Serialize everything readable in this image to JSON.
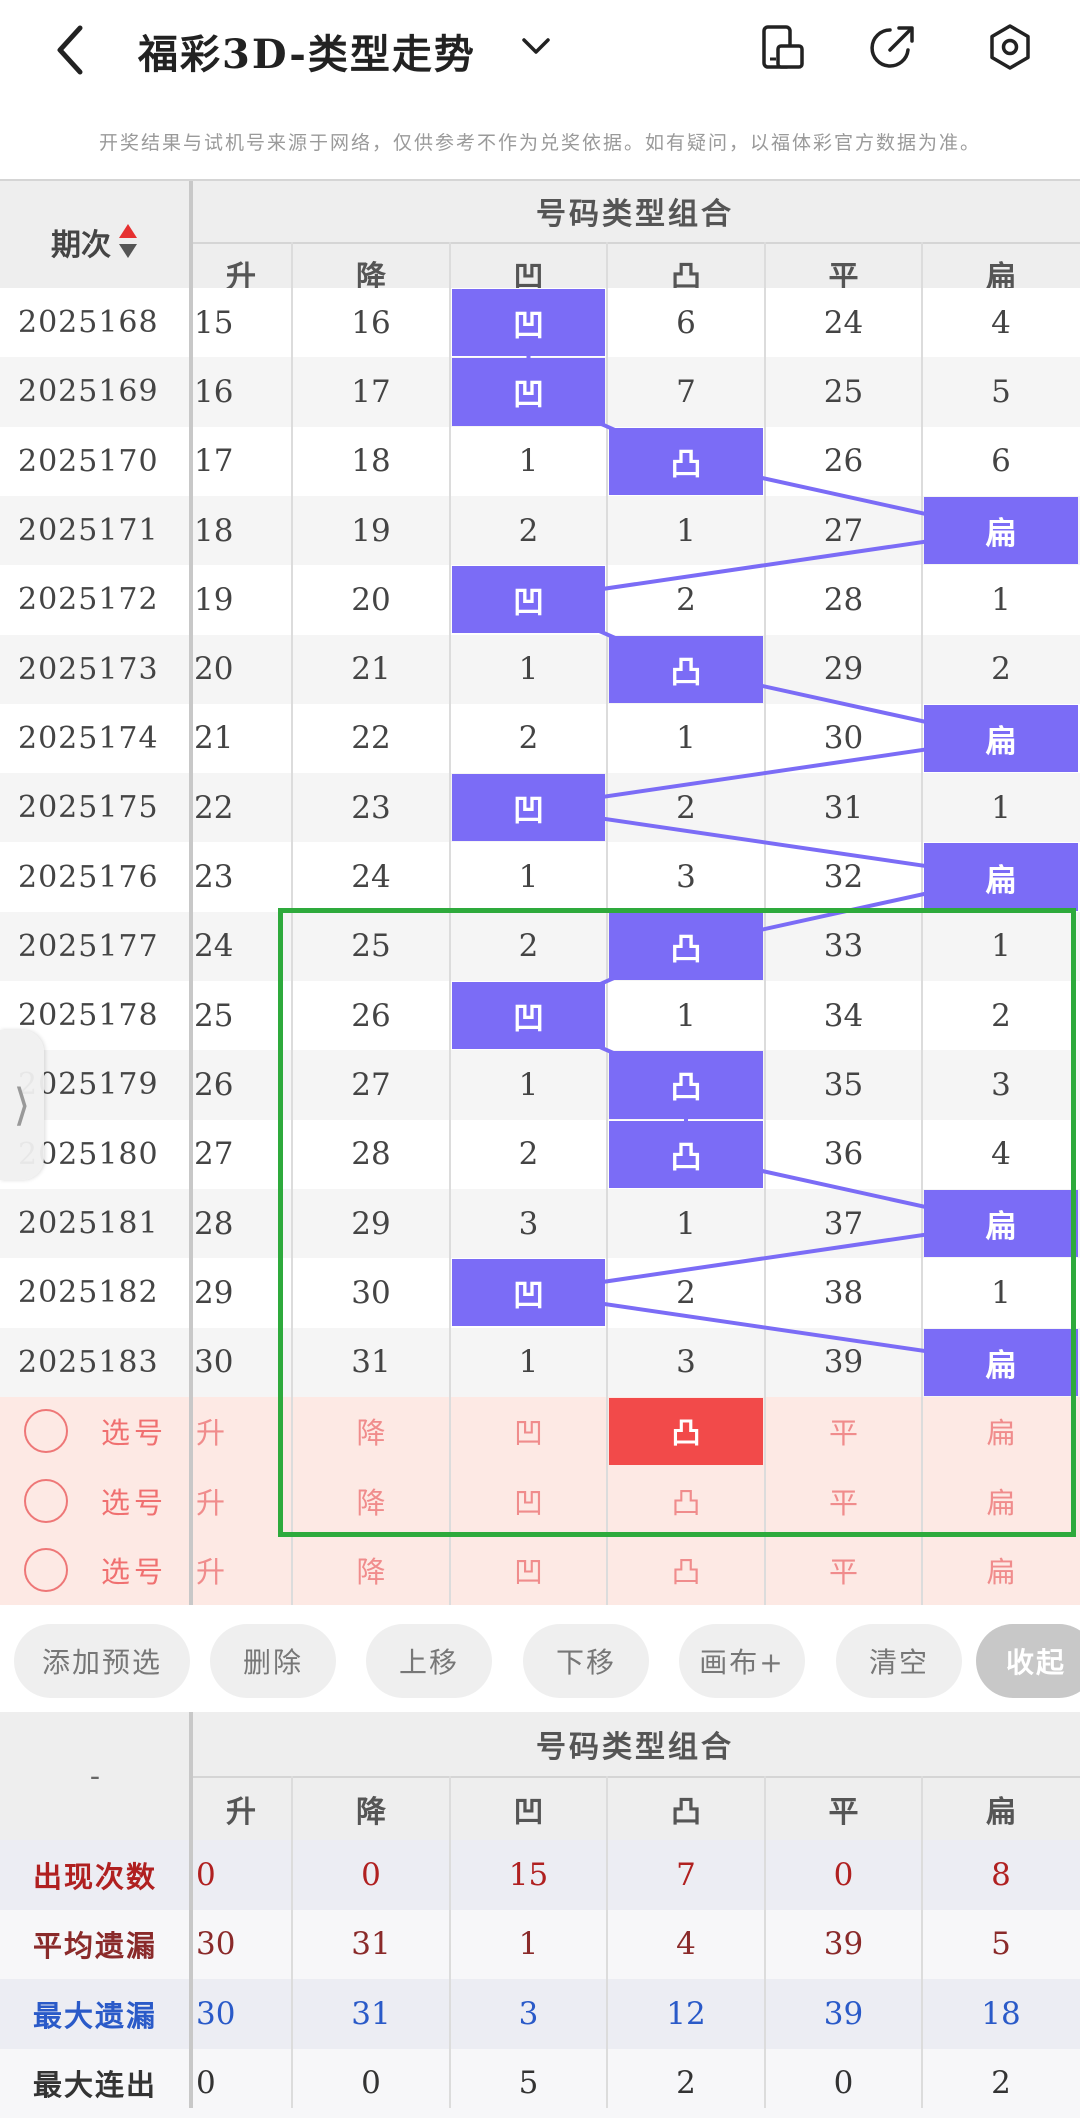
{
  "header": {
    "title": "福彩3D-类型走势",
    "icons": [
      "back-arrow-icon",
      "chevron-down-icon",
      "device-toggle-icon",
      "share-icon",
      "settings-icon"
    ]
  },
  "notice": "开奖结果与试机号来源于网络，仅供参考不作为兑奖依据。如有疑问，以福体彩官方数据为准。",
  "table": {
    "period_header": "期次",
    "group_header": "号码类型组合",
    "columns": [
      "升",
      "降",
      "凹",
      "凸",
      "平",
      "扁"
    ],
    "rows": [
      {
        "period": "2025168",
        "cells": [
          "15",
          "16",
          "凹",
          "6",
          "24",
          "4"
        ],
        "hit": 2
      },
      {
        "period": "2025169",
        "cells": [
          "16",
          "17",
          "凹",
          "7",
          "25",
          "5"
        ],
        "hit": 2
      },
      {
        "period": "2025170",
        "cells": [
          "17",
          "18",
          "1",
          "凸",
          "26",
          "6"
        ],
        "hit": 3
      },
      {
        "period": "2025171",
        "cells": [
          "18",
          "19",
          "2",
          "1",
          "27",
          "扁"
        ],
        "hit": 5
      },
      {
        "period": "2025172",
        "cells": [
          "19",
          "20",
          "凹",
          "2",
          "28",
          "1"
        ],
        "hit": 2
      },
      {
        "period": "2025173",
        "cells": [
          "20",
          "21",
          "1",
          "凸",
          "29",
          "2"
        ],
        "hit": 3
      },
      {
        "period": "2025174",
        "cells": [
          "21",
          "22",
          "2",
          "1",
          "30",
          "扁"
        ],
        "hit": 5
      },
      {
        "period": "2025175",
        "cells": [
          "22",
          "23",
          "凹",
          "2",
          "31",
          "1"
        ],
        "hit": 2
      },
      {
        "period": "2025176",
        "cells": [
          "23",
          "24",
          "1",
          "3",
          "32",
          "扁"
        ],
        "hit": 5
      },
      {
        "period": "2025177",
        "cells": [
          "24",
          "25",
          "2",
          "凸",
          "33",
          "1"
        ],
        "hit": 3
      },
      {
        "period": "2025178",
        "cells": [
          "25",
          "26",
          "凹",
          "1",
          "34",
          "2"
        ],
        "hit": 2
      },
      {
        "period": "2025179",
        "cells": [
          "26",
          "27",
          "1",
          "凸",
          "35",
          "3"
        ],
        "hit": 3
      },
      {
        "period": "2025180",
        "cells": [
          "27",
          "28",
          "2",
          "凸",
          "36",
          "4"
        ],
        "hit": 3
      },
      {
        "period": "2025181",
        "cells": [
          "28",
          "29",
          "3",
          "1",
          "37",
          "扁"
        ],
        "hit": 5
      },
      {
        "period": "2025182",
        "cells": [
          "29",
          "30",
          "凹",
          "2",
          "38",
          "1"
        ],
        "hit": 2
      },
      {
        "period": "2025183",
        "cells": [
          "30",
          "31",
          "1",
          "3",
          "39",
          "扁"
        ],
        "hit": 5
      }
    ],
    "select_rows": [
      {
        "label": "选号",
        "cells": [
          "升",
          "降",
          "凹",
          "凸",
          "平",
          "扁"
        ],
        "selected": 3
      },
      {
        "label": "选号",
        "cells": [
          "升",
          "降",
          "凹",
          "凸",
          "平",
          "扁"
        ],
        "selected": -1
      },
      {
        "label": "选号",
        "cells": [
          "升",
          "降",
          "凹",
          "凸",
          "平",
          "扁"
        ],
        "selected": -1
      }
    ]
  },
  "buttons": [
    "添加预选",
    "删除",
    "上移",
    "下移",
    "画布+",
    "清空",
    "收起"
  ],
  "side_handle": "⟩",
  "stats": {
    "corner": "-",
    "group_header": "号码类型组合",
    "columns": [
      "升",
      "降",
      "凹",
      "凸",
      "平",
      "扁"
    ],
    "rows": [
      {
        "label": "出现次数",
        "values": [
          "0",
          "0",
          "15",
          "7",
          "0",
          "8"
        ],
        "color": "#b02020"
      },
      {
        "label": "平均遗漏",
        "values": [
          "30",
          "31",
          "1",
          "4",
          "39",
          "5"
        ],
        "color": "#8a2a2a"
      },
      {
        "label": "最大遗漏",
        "values": [
          "30",
          "31",
          "3",
          "12",
          "39",
          "18"
        ],
        "color": "#2a5ac8"
      },
      {
        "label": "最大连出",
        "values": [
          "0",
          "0",
          "5",
          "2",
          "0",
          "2"
        ],
        "color": "#333333"
      }
    ]
  },
  "colors": {
    "hit": "#7b6cf6",
    "selected": "#f24a4a",
    "highlight_box": "#2eaa3c",
    "select_bg": "#fde9e4"
  }
}
